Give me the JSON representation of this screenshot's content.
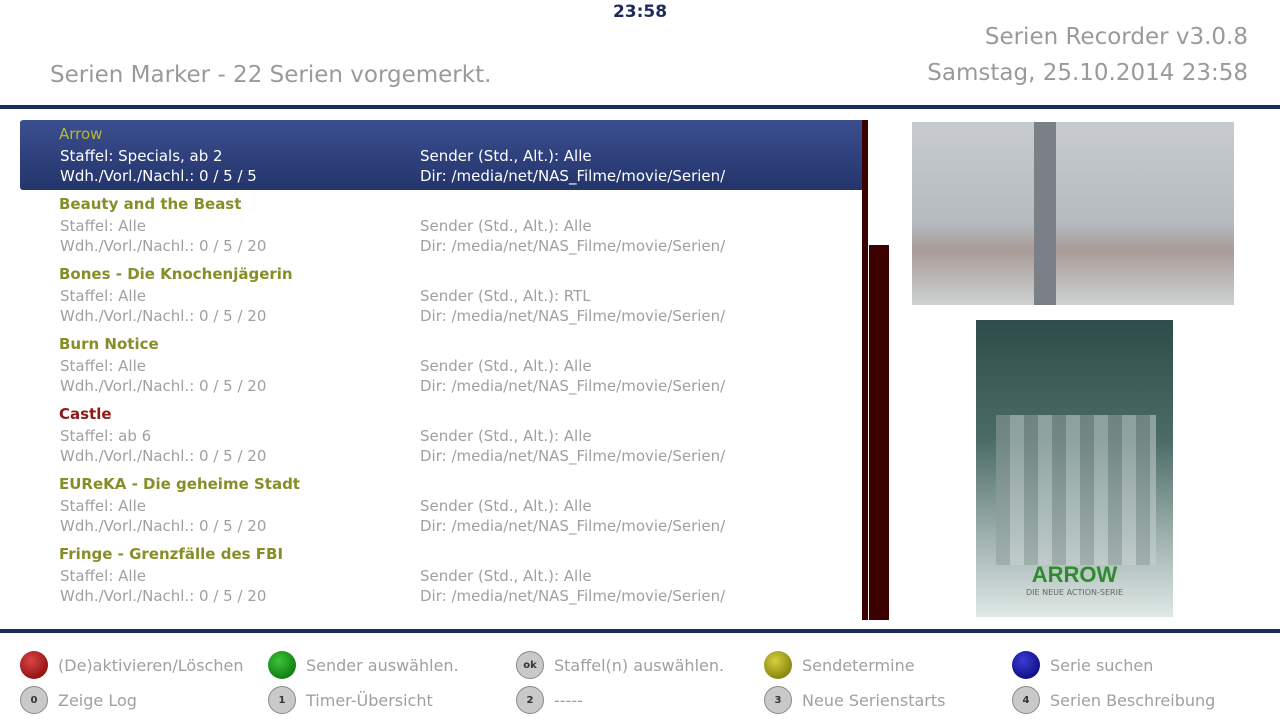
{
  "clock": "23:58",
  "header": {
    "title": "Serien Marker - 22 Serien vorgemerkt.",
    "plugin_version": "Serien Recorder v3.0.8",
    "datetime": "Samstag, 25.10.2014  23:58"
  },
  "list": [
    {
      "name": "Arrow",
      "staffel": "Staffel: Specials, ab 2",
      "wdh": "Wdh./Vorl./Nachl.: 0 / 5 / 5",
      "sender": "Sender (Std., Alt.): Alle",
      "dir": "Dir: /media/net/NAS_Filme/movie/Serien/"
    },
    {
      "name": "Beauty and the Beast",
      "staffel": "Staffel: Alle",
      "wdh": "Wdh./Vorl./Nachl.: 0 / 5 / 20",
      "sender": "Sender (Std., Alt.): Alle",
      "dir": "Dir: /media/net/NAS_Filme/movie/Serien/"
    },
    {
      "name": "Bones - Die Knochenjägerin",
      "staffel": "Staffel: Alle",
      "wdh": "Wdh./Vorl./Nachl.: 0 / 5 / 20",
      "sender": "Sender (Std., Alt.): RTL",
      "dir": "Dir: /media/net/NAS_Filme/movie/Serien/"
    },
    {
      "name": "Burn Notice",
      "staffel": "Staffel: Alle",
      "wdh": "Wdh./Vorl./Nachl.: 0 / 5 / 20",
      "sender": "Sender (Std., Alt.): Alle",
      "dir": "Dir: /media/net/NAS_Filme/movie/Serien/"
    },
    {
      "name": "Castle",
      "staffel": "Staffel: ab 6",
      "wdh": "Wdh./Vorl./Nachl.: 0 / 5 / 20",
      "sender": "Sender (Std., Alt.): Alle",
      "dir": "Dir: /media/net/NAS_Filme/movie/Serien/"
    },
    {
      "name": "EUReKA - Die geheime Stadt",
      "staffel": "Staffel: Alle",
      "wdh": "Wdh./Vorl./Nachl.: 0 / 5 / 20",
      "sender": "Sender (Std., Alt.): Alle",
      "dir": "Dir: /media/net/NAS_Filme/movie/Serien/"
    },
    {
      "name": "Fringe - Grenzfälle des FBI",
      "staffel": "Staffel: Alle",
      "wdh": "Wdh./Vorl./Nachl.: 0 / 5 / 20",
      "sender": "Sender (Std., Alt.): Alle",
      "dir": "Dir: /media/net/NAS_Filme/movie/Serien/"
    }
  ],
  "poster": {
    "title": "ARROW",
    "subtitle": "DIE NEUE ACTION-SERIE"
  },
  "buttons": {
    "row1": [
      {
        "key": "red",
        "label": "(De)aktivieren/Löschen"
      },
      {
        "key": "green",
        "label": "Sender auswählen."
      },
      {
        "key": "ok",
        "label": "Staffel(n) auswählen."
      },
      {
        "key": "yellow",
        "label": "Sendetermine"
      },
      {
        "key": "blue",
        "label": "Serie suchen"
      }
    ],
    "row2": [
      {
        "key": "0",
        "label": "Zeige Log"
      },
      {
        "key": "1",
        "label": "Timer-Übersicht"
      },
      {
        "key": "2",
        "label": "-----"
      },
      {
        "key": "3",
        "label": "Neue Serienstarts"
      },
      {
        "key": "4",
        "label": "Serien Beschreibung"
      }
    ]
  },
  "colors": {
    "accent": "#1e2a5e",
    "selection": "#2e3f7c",
    "series_name": "#868e28",
    "alert": "#8c1a1a",
    "scrollbar": "#3b0000"
  }
}
